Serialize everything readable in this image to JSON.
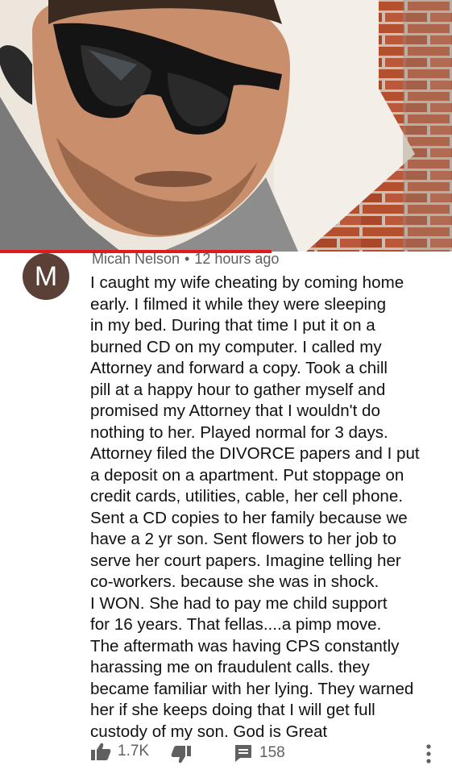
{
  "comment": {
    "author": "Micah Nelson",
    "time": "12 hours ago",
    "avatar_letter": "M",
    "body": "I caught my wife cheating by coming home\nearly. I filmed it while they were sleeping\nin my bed. During that time I put it on a\nburned CD on my computer. I called my\nAttorney and forward a copy. Took a chill\npill at a happy hour to gather myself and\npromised my Attorney that I wouldn't do\nnothing to her. Played normal for 3 days.\nAttorney filed the DIVORCE papers and I put\na deposit on a apartment. Put stoppage on\ncredit cards, utilities, cable, her cell phone.\nSent a CD copies to her family because we\nhave a 2 yr son. Sent flowers to her job to\nserve her court papers. Imagine telling her\nco-workers. because she was in shock.\nI WON. She had to pay me child support\nfor 16 years. That fellas....a pimp move.\nThe aftermath was having CPS constantly\nharassing me on fraudulent calls. they\nbecame familiar with her lying. They warned\nher if she keeps doing that I will get full\ncustody of my son. God is Great",
    "likes": "1.7K",
    "replies": "158"
  },
  "video": {
    "progress_fraction": 0.6
  },
  "icons": {
    "like": "thumbs-up-icon",
    "dislike": "thumbs-down-icon",
    "reply": "comment-icon",
    "menu": "more-vertical-icon"
  },
  "colors": {
    "progress": "#e01b1b",
    "avatar": "#5b4037"
  }
}
